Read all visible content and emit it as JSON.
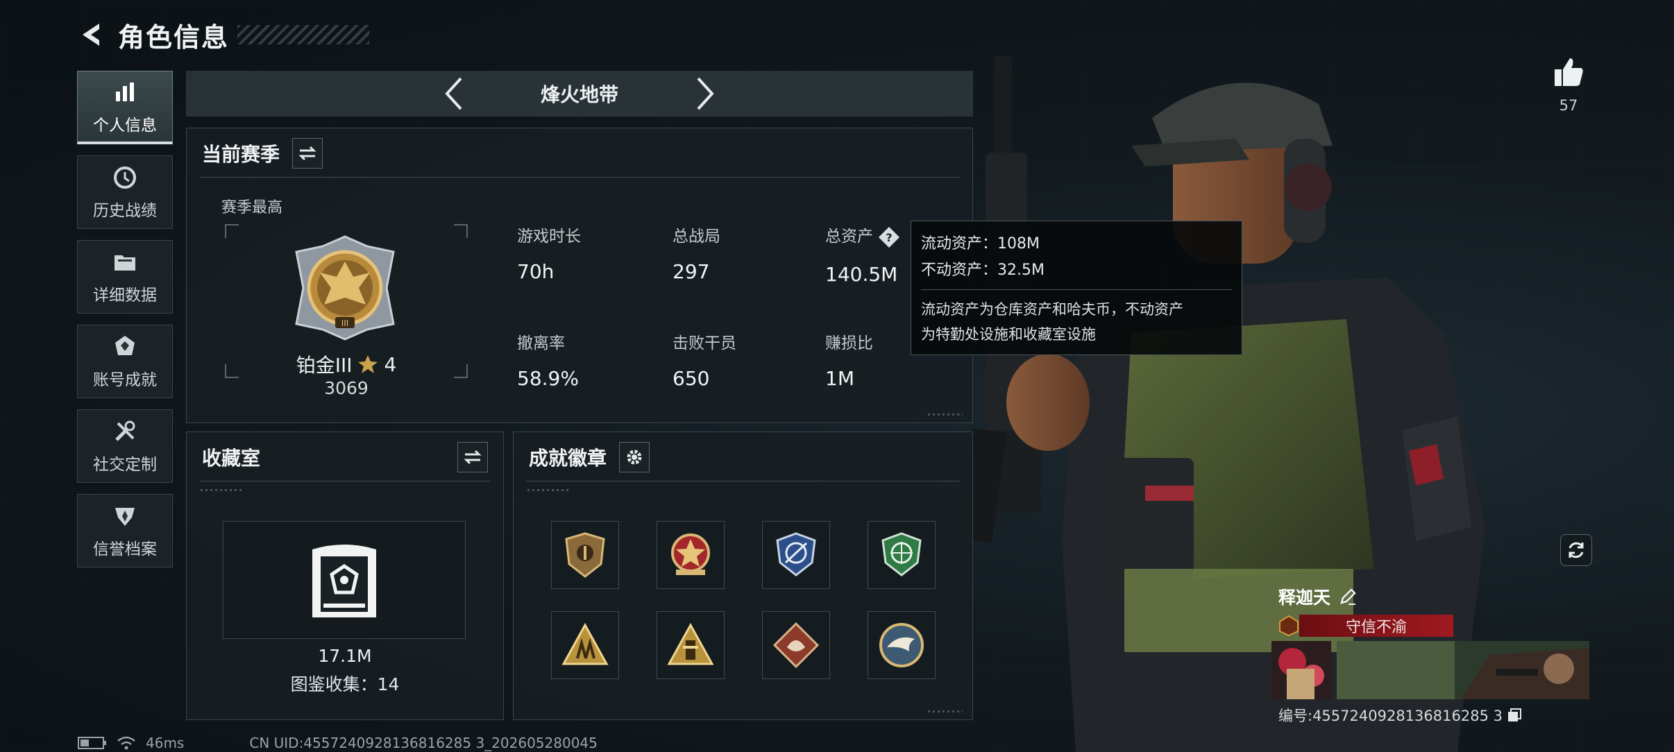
{
  "header": {
    "title": "角色信息"
  },
  "sidebar": {
    "items": [
      {
        "label": "个人信息",
        "active": true
      },
      {
        "label": "历史战绩",
        "active": false
      },
      {
        "label": "详细数据",
        "active": false
      },
      {
        "label": "账号成就",
        "active": false
      },
      {
        "label": "社交定制",
        "active": false
      },
      {
        "label": "信誉档案",
        "active": false
      }
    ]
  },
  "mode_selector": {
    "current": "烽火地带"
  },
  "season": {
    "title": "当前赛季",
    "best_label": "赛季最高",
    "rank": {
      "name": "铂金III",
      "stars": "4",
      "score": "3069"
    },
    "stats": [
      {
        "label": "游戏时长",
        "value": "70h"
      },
      {
        "label": "总战局",
        "value": "297"
      },
      {
        "label": "总资产",
        "value": "140.5M"
      },
      {
        "label": "撤离率",
        "value": "58.9%"
      },
      {
        "label": "击败干员",
        "value": "650"
      },
      {
        "label": "赚损比",
        "value": "1M"
      }
    ]
  },
  "asset_tooltip": {
    "liquid": "流动资产：108M",
    "fixed": "不动资产：32.5M",
    "desc_line1": "流动资产为仓库资产和哈夫币，不动资产",
    "desc_line2": "为特勤处设施和收藏室设施"
  },
  "collection": {
    "title": "收藏室",
    "value": "17.1M",
    "count_text": "图鉴收集：14"
  },
  "achievements": {
    "title": "成就徽章",
    "badges": [
      {
        "icon": "shield-badge-icon",
        "color": "#8a6a3a"
      },
      {
        "icon": "star-emblem-badge-icon",
        "color": "#a3262a"
      },
      {
        "icon": "blue-shield-badge-icon",
        "color": "#2c4f8c"
      },
      {
        "icon": "green-shield-badge-icon",
        "color": "#2f7a45"
      },
      {
        "icon": "gold-triangle-soldiers-icon",
        "color": "#b8923c"
      },
      {
        "icon": "gold-triangle-tower-icon",
        "color": "#b8923c"
      },
      {
        "icon": "red-diamond-beast-icon",
        "color": "#8c3b2a"
      },
      {
        "icon": "eagle-medallion-icon",
        "color": "#3d5a72"
      }
    ]
  },
  "profile": {
    "likes": "57",
    "name": "释迦天",
    "title": "守信不渝",
    "id_text": "编号:4557240928136816285 3"
  },
  "status": {
    "ping": "46ms",
    "uid": "CN UID:4557240928136816285 3_202605280045"
  }
}
